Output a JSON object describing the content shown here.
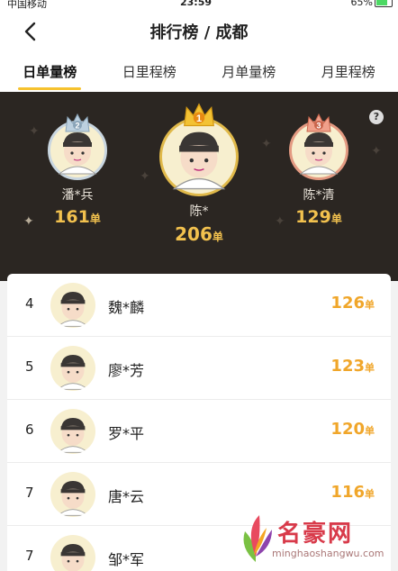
{
  "status": {
    "carrier": "中国移动",
    "time": "23:59",
    "battery": "65%"
  },
  "nav": {
    "title": "排行榜 / 成都"
  },
  "tabs": [
    {
      "label": "日单量榜",
      "active": true
    },
    {
      "label": "日里程榜",
      "active": false
    },
    {
      "label": "月单量榜",
      "active": false
    },
    {
      "label": "月里程榜",
      "active": false
    }
  ],
  "podium": {
    "help": "?",
    "first": {
      "rank": "1",
      "name": "陈*",
      "count": "206",
      "unit": "单"
    },
    "second": {
      "rank": "2",
      "name": "潘*兵",
      "count": "161",
      "unit": "单"
    },
    "third": {
      "rank": "3",
      "name": "陈*清",
      "count": "129",
      "unit": "单"
    }
  },
  "rows": [
    {
      "rank": "4",
      "name": "魏*麟",
      "count": "126",
      "unit": "单"
    },
    {
      "rank": "5",
      "name": "廖*芳",
      "count": "123",
      "unit": "单"
    },
    {
      "rank": "6",
      "name": "罗*平",
      "count": "120",
      "unit": "单"
    },
    {
      "rank": "7",
      "name": "唐*云",
      "count": "116",
      "unit": "单"
    },
    {
      "rank": "7",
      "name": "邹*军",
      "count": "",
      "unit": ""
    }
  ],
  "watermark": {
    "brand": "名豪网",
    "site": "minghaoshangwu.com"
  },
  "colors": {
    "accent": "#f6c22e",
    "gold": "#f2c14e",
    "orange": "#f0a62a",
    "dark": "#2b2622"
  }
}
